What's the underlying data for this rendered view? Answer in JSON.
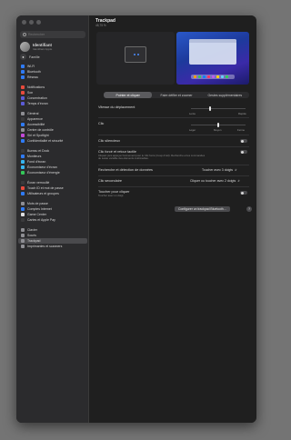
{
  "window": {
    "title": "Trackpad",
    "subtitle": "48,75 %"
  },
  "search": {
    "placeholder": "Rechercher"
  },
  "profile": {
    "name": "Identifiant",
    "sub": "Identifiant Apple"
  },
  "family": {
    "label": "Famille"
  },
  "sidebar": {
    "items": [
      {
        "label": "Wi-Fi",
        "color": "#2f7bf6"
      },
      {
        "label": "Bluetooth",
        "color": "#2f7bf6"
      },
      {
        "label": "Réseau",
        "color": "#2f7bf6"
      },
      {
        "label": "Notifications",
        "color": "#e84a3c"
      },
      {
        "label": "Son",
        "color": "#e84a3c"
      },
      {
        "label": "Concentration",
        "color": "#5b5bd6"
      },
      {
        "label": "Temps d'écran",
        "color": "#5b5bd6"
      },
      {
        "label": "Général",
        "color": "#8e8e93"
      },
      {
        "label": "Apparence",
        "color": "#3a3a3c"
      },
      {
        "label": "Accessibilité",
        "color": "#2f7bf6"
      },
      {
        "label": "Centre de contrôle",
        "color": "#8e8e93"
      },
      {
        "label": "Siri et Spotlight",
        "color": "#c24ad8"
      },
      {
        "label": "Confidentialité et sécurité",
        "color": "#2f7bf6"
      },
      {
        "label": "Bureau et Dock",
        "color": "#3a3a3c"
      },
      {
        "label": "Moniteurs",
        "color": "#2f7bf6"
      },
      {
        "label": "Fond d'écran",
        "color": "#36b5f0"
      },
      {
        "label": "Économiseur d'écran",
        "color": "#36b5f0"
      },
      {
        "label": "Économiseur d'énergie",
        "color": "#34c759"
      },
      {
        "label": "Écran verrouillé",
        "color": "#3a3a3c"
      },
      {
        "label": "Touch ID et mot de passe",
        "color": "#e84a3c"
      },
      {
        "label": "Utilisateurs et groupes",
        "color": "#2f7bf6"
      },
      {
        "label": "Mots de passe",
        "color": "#8e8e93"
      },
      {
        "label": "Comptes Internet",
        "color": "#2f7bf6"
      },
      {
        "label": "Game Center",
        "color": "#e0e0e0"
      },
      {
        "label": "Cartes et Apple Pay",
        "color": "#3a3a3c"
      },
      {
        "label": "Clavier",
        "color": "#8e8e93"
      },
      {
        "label": "Souris",
        "color": "#8e8e93"
      },
      {
        "label": "Trackpad",
        "color": "#8e8e93",
        "selected": true
      },
      {
        "label": "Imprimantes et scanners",
        "color": "#8e8e93"
      }
    ]
  },
  "tabs": [
    {
      "label": "Pointer et cliquer",
      "active": true
    },
    {
      "label": "Faire défiler et zoomer",
      "active": false
    },
    {
      "label": "Gestes supplémentaires",
      "active": false
    }
  ],
  "settings": {
    "tracking_speed": {
      "label": "Vitesse du déplacement",
      "min_label": "Lente",
      "max_label": "Rapide",
      "value": 0.35
    },
    "click": {
      "label": "Clic",
      "labels": [
        "Léger",
        "Moyen",
        "Ferme"
      ],
      "value": 0.5
    },
    "silent_click": {
      "label": "Clic silencieux",
      "on": false
    },
    "force_click": {
      "label": "Clic forcé et retour tactile",
      "desc": "Cliquez puis appuyez fermement pour le Clic forcé (Coup d'œil). Recherche et les commandes de saisie variable des éléments multimédias.",
      "on": false
    },
    "lookup": {
      "label": "Recherche et détection de données",
      "value": "Toucher avec 3 doigts"
    },
    "secondary_click": {
      "label": "Clic secondaire",
      "value": "Cliquer ou toucher avec 2 doigts"
    },
    "tap_to_click": {
      "label": "Toucher pour cliquer",
      "desc": "Toucher avec un doigt",
      "on": false
    },
    "bluetooth_button": "Configurer un trackpad Bluetooth…",
    "help": "?"
  }
}
